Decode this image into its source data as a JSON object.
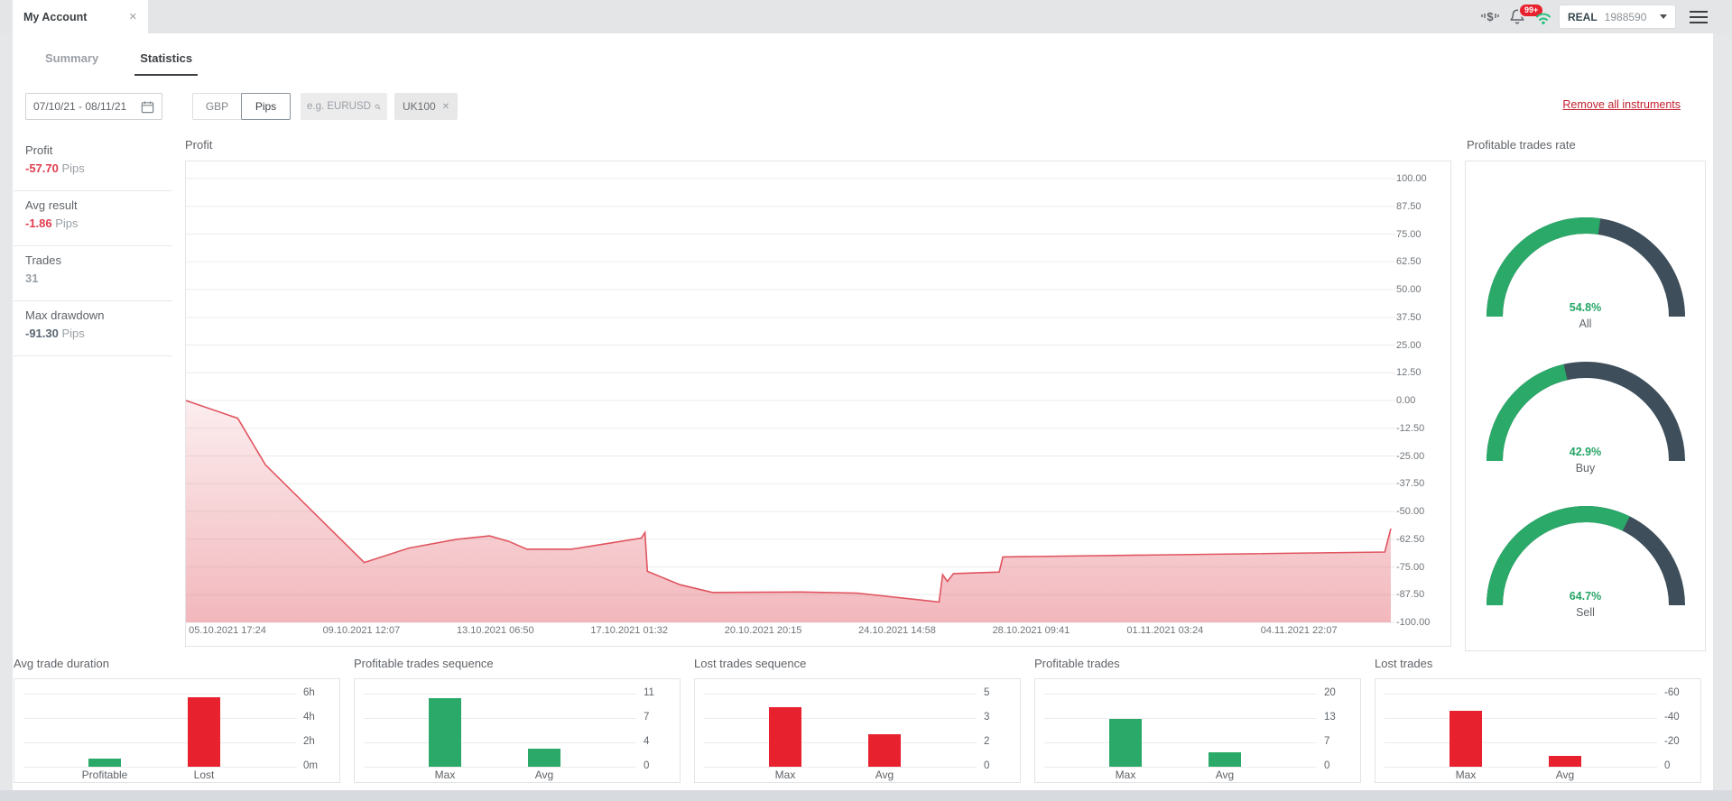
{
  "topbar": {
    "tab_title": "My Account",
    "close_glyph": "✕",
    "notifications_badge": "99+",
    "account_type": "REAL",
    "account_number": "1988590"
  },
  "tabs": {
    "summary": "Summary",
    "statistics": "Statistics"
  },
  "filters": {
    "date_range": "07/10/21 - 08/11/21",
    "currency_button": "GBP",
    "unit_button": "Pips",
    "search_placeholder": "e.g. EURUSD",
    "instrument_tag": "UK100",
    "tag_close_glyph": "✕",
    "remove_all_link": "Remove all instruments"
  },
  "stats": [
    {
      "label": "Profit",
      "value": "-57.70",
      "suffix": " Pips",
      "style": "v-red"
    },
    {
      "label": "Avg result",
      "value": "-1.86",
      "suffix": " Pips",
      "style": "v-red"
    },
    {
      "label": "Trades",
      "value": "31",
      "suffix": "",
      "style": "v-gray"
    },
    {
      "label": "Max drawdown",
      "value": "-91.30",
      "suffix": " Pips",
      "style": "v-dark"
    }
  ],
  "colors": {
    "green": "#2aa968",
    "red": "#e8212f",
    "gauge_track": "#3e4e5a",
    "line_red": "#e05560",
    "link_red": "#c2202f"
  },
  "chart_data": [
    {
      "type": "area",
      "title": "Profit",
      "ylim": [
        -100,
        100
      ],
      "y_ticks": [
        "100.00",
        "87.50",
        "75.00",
        "62.50",
        "50.00",
        "37.50",
        "25.00",
        "12.50",
        "0.00",
        "-12.50",
        "-25.00",
        "-37.50",
        "-50.00",
        "-62.50",
        "-75.00",
        "-87.50",
        "-100.00"
      ],
      "x_labels": [
        "05.10.2021 17:24",
        "09.10.2021 12:07",
        "13.10.2021 06:50",
        "17.10.2021 01:32",
        "20.10.2021 20:15",
        "24.10.2021 14:58",
        "28.10.2021 09:41",
        "01.11.2021 03:24",
        "04.11.2021 22:07"
      ],
      "points": [
        [
          0,
          0
        ],
        [
          0.043,
          -8
        ],
        [
          0.066,
          -29
        ],
        [
          0.12,
          -58
        ],
        [
          0.148,
          -73
        ],
        [
          0.185,
          -66.5
        ],
        [
          0.225,
          -62.5
        ],
        [
          0.252,
          -61
        ],
        [
          0.268,
          -63.5
        ],
        [
          0.283,
          -67
        ],
        [
          0.32,
          -67
        ],
        [
          0.355,
          -64
        ],
        [
          0.378,
          -62
        ],
        [
          0.381,
          -59.5
        ],
        [
          0.383,
          -77
        ],
        [
          0.41,
          -83
        ],
        [
          0.437,
          -86.5
        ],
        [
          0.51,
          -86.3
        ],
        [
          0.557,
          -86.8
        ],
        [
          0.625,
          -90.8
        ],
        [
          0.628,
          -78.5
        ],
        [
          0.632,
          -81.5
        ],
        [
          0.637,
          -78
        ],
        [
          0.675,
          -77.3
        ],
        [
          0.678,
          -70.5
        ],
        [
          0.995,
          -68.3
        ],
        [
          1,
          -57.7
        ]
      ],
      "grid": true
    },
    {
      "type": "gauge",
      "title": "Profitable trades rate",
      "gauges": [
        {
          "label": "All",
          "value": 54.8,
          "value_label": "54.8%"
        },
        {
          "label": "Buy",
          "value": 42.9,
          "value_label": "42.9%"
        },
        {
          "label": "Sell",
          "value": 64.7,
          "value_label": "64.7%"
        }
      ]
    },
    {
      "type": "bar",
      "title": "Avg trade duration",
      "categories": [
        "Profitable",
        "Lost"
      ],
      "values": [
        0.7,
        5.7
      ],
      "bar_colors": [
        "green",
        "red"
      ],
      "ticks": [
        "6h",
        "4h",
        "2h",
        "0m"
      ],
      "axis_max": 6
    },
    {
      "type": "bar",
      "title": "Profitable trades sequence",
      "categories": [
        "Max",
        "Avg"
      ],
      "values": [
        10.3,
        2.7
      ],
      "bar_colors": [
        "green",
        "green"
      ],
      "ticks": [
        "11",
        "7",
        "4",
        "0"
      ],
      "axis_max": 11
    },
    {
      "type": "bar",
      "title": "Lost trades sequence",
      "categories": [
        "Max",
        "Avg"
      ],
      "values": [
        4.1,
        2.2
      ],
      "bar_colors": [
        "red",
        "red"
      ],
      "ticks": [
        "5",
        "3",
        "2",
        "0"
      ],
      "axis_max": 5
    },
    {
      "type": "bar",
      "title": "Profitable trades",
      "categories": [
        "Max",
        "Avg"
      ],
      "values": [
        13,
        4
      ],
      "bar_colors": [
        "green",
        "green"
      ],
      "ticks": [
        "20",
        "13",
        "7",
        "0"
      ],
      "axis_max": 20
    },
    {
      "type": "bar",
      "title": "Lost trades",
      "categories": [
        "Max",
        "Avg"
      ],
      "values": [
        -46,
        -9
      ],
      "bar_colors": [
        "red",
        "red"
      ],
      "ticks": [
        "-60",
        "-40",
        "-20",
        "0"
      ],
      "axis_max": 60
    }
  ]
}
